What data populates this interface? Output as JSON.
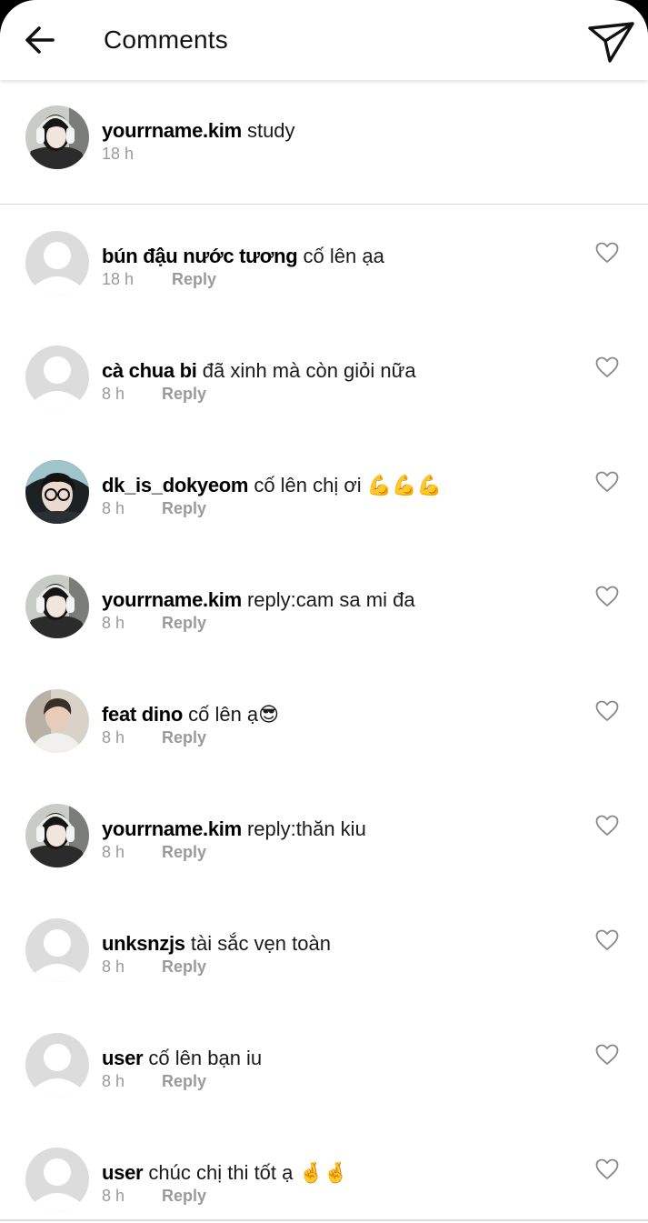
{
  "header": {
    "title": "Comments",
    "back_icon": "arrow-left-icon",
    "share_icon": "paper-plane-icon"
  },
  "caption": {
    "username": "yourrname.kim",
    "text": "study",
    "time": "18 h"
  },
  "comments": [
    {
      "username": "bún đậu nước tương",
      "text": "cố lên ạa",
      "time": "18 h",
      "reply": "Reply",
      "avatar": "default"
    },
    {
      "username": "cà chua bi",
      "text": "đã xinh mà còn giỏi nữa",
      "time": "8 h",
      "reply": "Reply",
      "avatar": "default"
    },
    {
      "username": "dk_is_dokyeom",
      "text": "cố lên chị ơi 💪💪💪",
      "time": "8 h",
      "reply": "Reply",
      "avatar": "photo-glasses"
    },
    {
      "username": "yourrname.kim",
      "text": "reply:cam sa mi đa",
      "time": "8 h",
      "reply": "Reply",
      "avatar": "photo-headphones"
    },
    {
      "username": "feat dino",
      "text": "cố lên ạ😎",
      "time": "8 h",
      "reply": "Reply",
      "avatar": "photo-boy"
    },
    {
      "username": "yourrname.kim",
      "text": "reply:thăn kiu",
      "time": "8 h",
      "reply": "Reply",
      "avatar": "photo-headphones"
    },
    {
      "username": "unksnzjs",
      "text": "tài sắc vẹn toàn",
      "time": "8 h",
      "reply": "Reply",
      "avatar": "default"
    },
    {
      "username": "user",
      "text": "cố lên bạn iu",
      "time": "8 h",
      "reply": "Reply",
      "avatar": "default"
    },
    {
      "username": "user",
      "text": "chúc chị thi tốt ạ 🤞🤞",
      "time": "8 h",
      "reply": "Reply",
      "avatar": "default"
    }
  ],
  "colors": {
    "background": "#ffffff",
    "text": "#111111",
    "muted": "#9a9a9a",
    "divider": "#d6d6d6",
    "default_avatar": "#dcdcdc"
  }
}
